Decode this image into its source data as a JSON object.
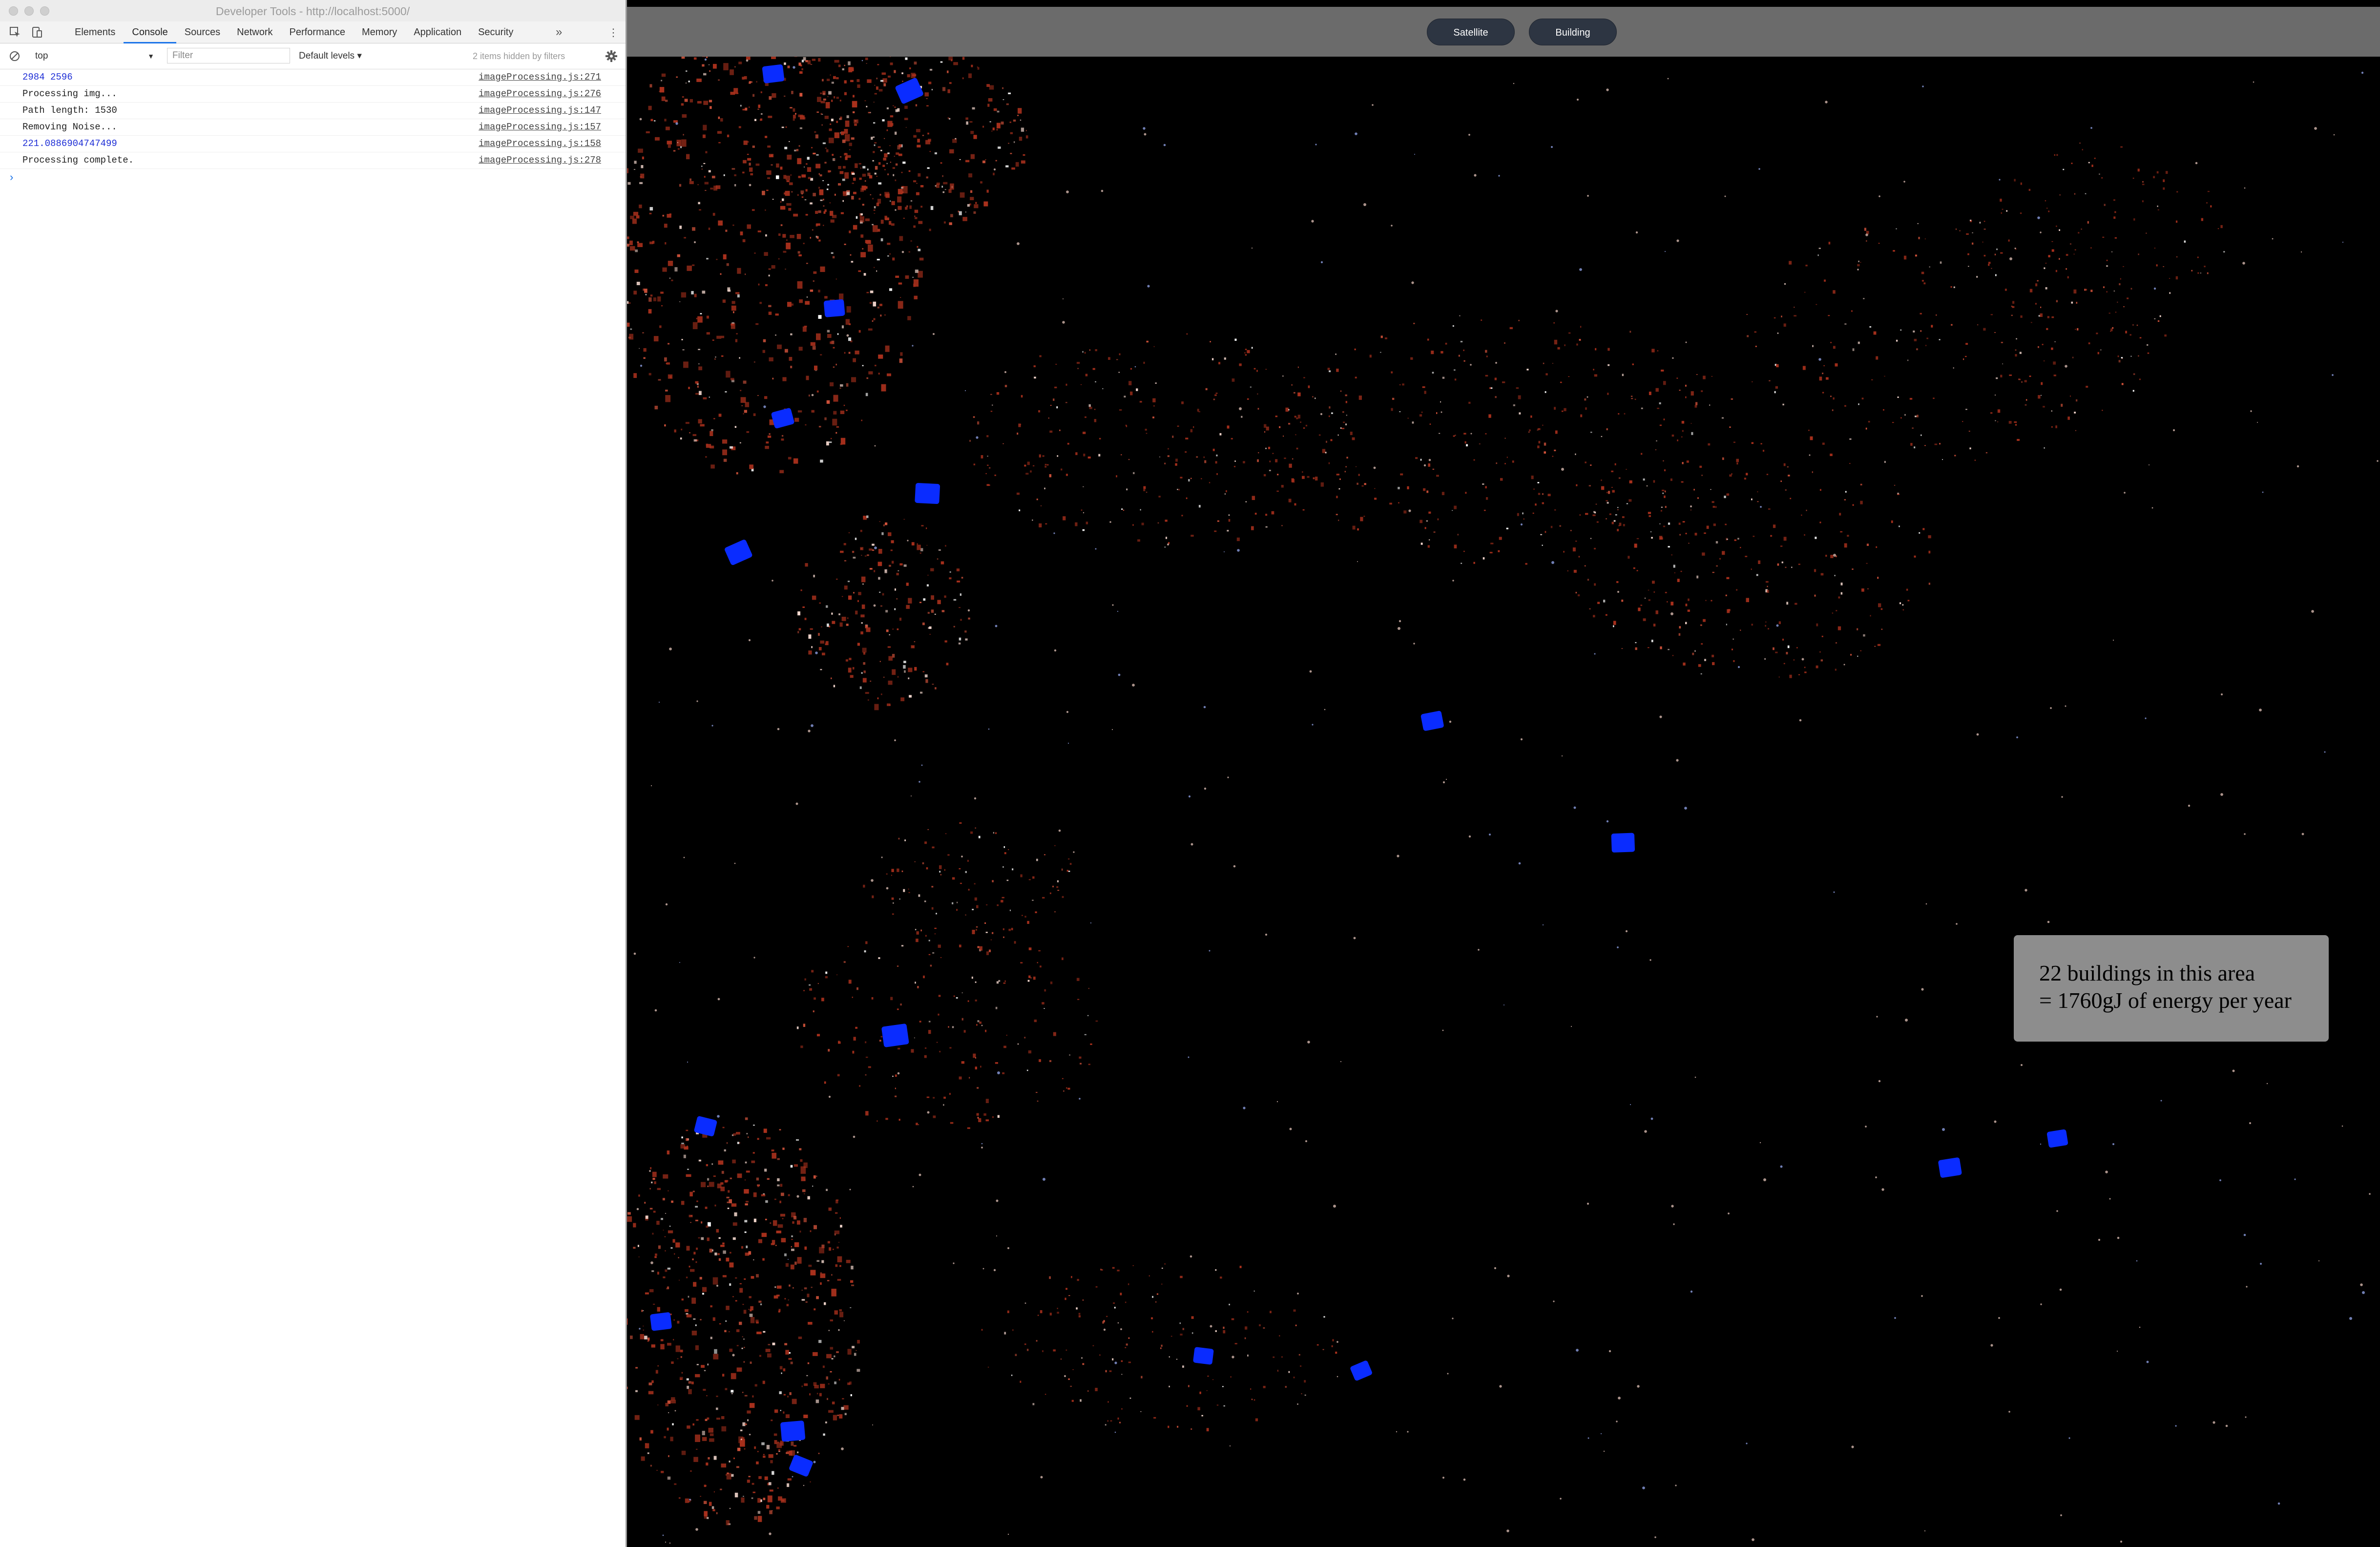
{
  "devtools": {
    "title": "Developer Tools - http://localhost:5000/",
    "tabs": [
      {
        "label": "Elements",
        "active": false
      },
      {
        "label": "Console",
        "active": true
      },
      {
        "label": "Sources",
        "active": false
      },
      {
        "label": "Network",
        "active": false
      },
      {
        "label": "Performance",
        "active": false
      },
      {
        "label": "Memory",
        "active": false
      },
      {
        "label": "Application",
        "active": false
      },
      {
        "label": "Security",
        "active": false
      }
    ],
    "more_tabs": "»",
    "menu": "⋮",
    "context": "top",
    "filter_placeholder": "Filter",
    "levels": "Default levels ▾",
    "hidden_note": "2 items hidden by filters",
    "log": [
      {
        "message": "2984 2596",
        "source": "imageProcessing.js:271",
        "kind": "num"
      },
      {
        "message": "Processing img...",
        "source": "imageProcessing.js:276",
        "kind": "text"
      },
      {
        "message": "Path length: 1530",
        "source": "imageProcessing.js:147",
        "kind": "text"
      },
      {
        "message": "Removing Noise...",
        "source": "imageProcessing.js:157",
        "kind": "text"
      },
      {
        "message": "221.0886904747499",
        "source": "imageProcessing.js:158",
        "kind": "num"
      },
      {
        "message": "Processing complete.",
        "source": "imageProcessing.js:278",
        "kind": "text"
      }
    ],
    "prompt": "›",
    "icons": [
      "inspect-icon",
      "device-toolbar-icon",
      "clear-console-icon",
      "settings-gear-icon"
    ]
  },
  "app": {
    "buttons": {
      "satellite": "Satellite",
      "building": "Building"
    },
    "info": {
      "line1": "22 buildings in this area",
      "line2": "= 1760gJ of energy per year"
    },
    "colors": {
      "header": "#6b6b6b",
      "button": "#2d3542",
      "building_marker": "#0a2cff",
      "urban_red": "#a8301c",
      "info_box": "#8d8d8d"
    }
  }
}
